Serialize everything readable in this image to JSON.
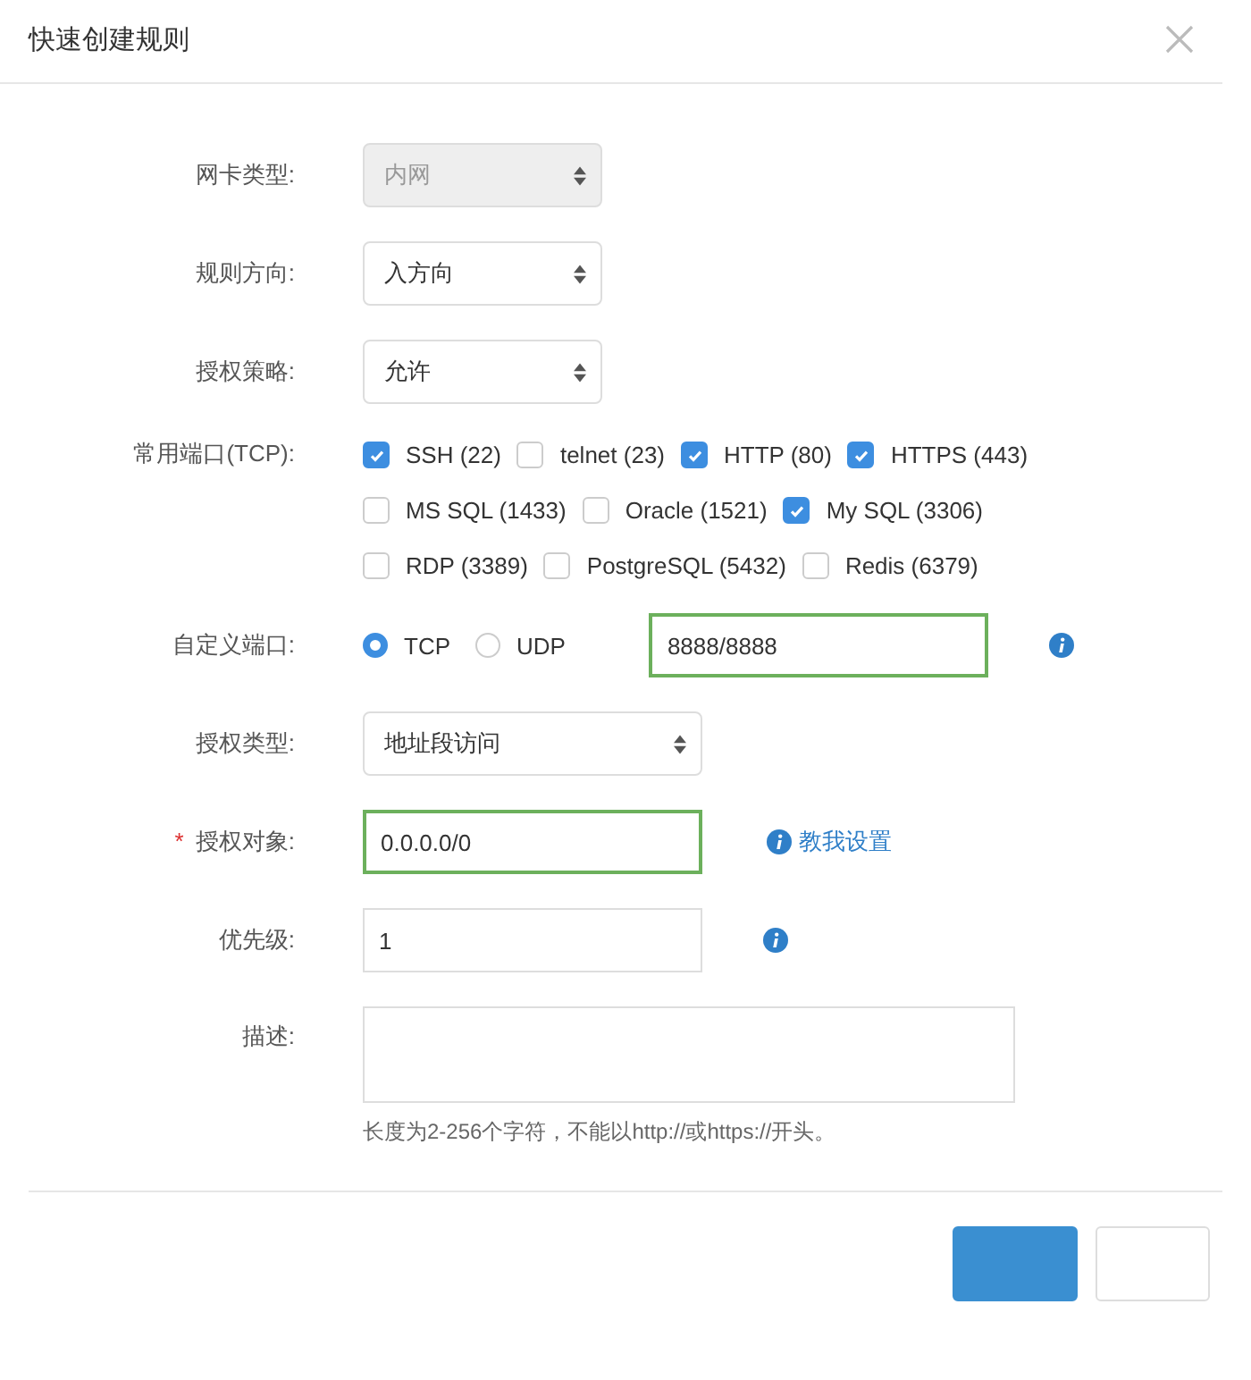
{
  "dialog": {
    "title": "快速创建规则"
  },
  "fields": [
    {
      "kind": "select",
      "label": "网卡类型:",
      "value": "内网",
      "disabled": true
    },
    {
      "kind": "select",
      "label": "规则方向:",
      "value": "入方向",
      "disabled": false
    },
    {
      "kind": "select",
      "label": "授权策略:",
      "value": "允许",
      "disabled": false
    },
    {
      "kind": "checkboxes",
      "label": "常用端口(TCP):",
      "rows": [
        [
          {
            "label": "SSH (22)",
            "checked": true
          },
          {
            "label": "telnet (23)",
            "checked": false
          },
          {
            "label": "HTTP (80)",
            "checked": true
          },
          {
            "label": "HTTPS (443)",
            "checked": true
          }
        ],
        [
          {
            "label": "MS SQL (1433)",
            "checked": false
          },
          {
            "label": "Oracle (1521)",
            "checked": false
          },
          {
            "label": "My SQL (3306)",
            "checked": true
          }
        ],
        [
          {
            "label": "RDP (3389)",
            "checked": false
          },
          {
            "label": "PostgreSQL (5432)",
            "checked": false
          },
          {
            "label": "Redis (6379)",
            "checked": false
          }
        ]
      ]
    },
    {
      "kind": "protocol",
      "label": "自定义端口:",
      "options": [
        {
          "label": "TCP",
          "selected": true
        },
        {
          "label": "UDP",
          "selected": false
        }
      ],
      "value": "8888/8888",
      "valid": true,
      "info_icon": true
    },
    {
      "kind": "wide_select",
      "label": "授权类型:",
      "value": "地址段访问",
      "disabled": false
    },
    {
      "kind": "input",
      "label": "授权对象:",
      "required_mark": "*",
      "value": "0.0.0.0/0",
      "valid": true,
      "help_link": "教我设置"
    },
    {
      "kind": "input",
      "label": "优先级:",
      "value": "1",
      "valid": false,
      "info_icon": true
    },
    {
      "kind": "textarea",
      "label": "描述:",
      "hint": "长度为2-256个字符，不能以http://或https://开头。"
    }
  ],
  "footer_buttons": [
    {
      "kind": "primary"
    },
    {
      "kind": "secondary"
    }
  ]
}
